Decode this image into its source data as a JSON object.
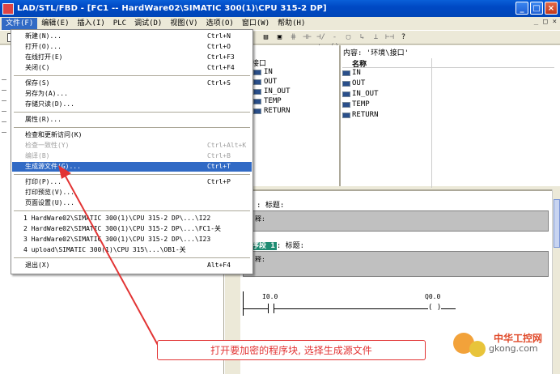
{
  "window": {
    "title": "LAD/STL/FBD  - [FC1 -- HardWare02\\SIMATIC 300(1)\\CPU 315-2 DP]",
    "min": "_",
    "max": "□",
    "close": "×"
  },
  "menubar": {
    "items": [
      "文件(F)",
      "编辑(E)",
      "插入(I)",
      "PLC",
      "调试(D)",
      "视图(V)",
      "选项(O)",
      "窗口(W)",
      "帮助(H)"
    ],
    "mdi_controls": [
      "_",
      "□",
      "×"
    ]
  },
  "file_menu": {
    "items": [
      {
        "label": "新建(N)...",
        "shortcut": "Ctrl+N",
        "state": "normal"
      },
      {
        "label": "打开(O)...",
        "shortcut": "Ctrl+O",
        "state": "normal"
      },
      {
        "label": "在线打开(E)",
        "shortcut": "Ctrl+F3",
        "state": "normal"
      },
      {
        "label": "关闭(C)",
        "shortcut": "Ctrl+F4",
        "state": "normal"
      },
      {
        "label": "保存(S)",
        "shortcut": "Ctrl+S",
        "state": "normal"
      },
      {
        "label": "另存为(A)...",
        "shortcut": "",
        "state": "normal"
      },
      {
        "label": "存储只读(D)...",
        "shortcut": "",
        "state": "normal"
      },
      {
        "label": "属性(R)...",
        "shortcut": "",
        "state": "normal"
      },
      {
        "label": "检查和更新访问(K)",
        "shortcut": "",
        "state": "normal"
      },
      {
        "label": "检查一致性(Y)",
        "shortcut": "Ctrl+Alt+K",
        "state": "disabled"
      },
      {
        "label": "编译(B)",
        "shortcut": "Ctrl+B",
        "state": "disabled"
      },
      {
        "label": "生成源文件(G)...",
        "shortcut": "Ctrl+T",
        "state": "selected"
      },
      {
        "label": "打印(P)...",
        "shortcut": "Ctrl+P",
        "state": "normal"
      },
      {
        "label": "打印预览(V)...",
        "shortcut": "",
        "state": "normal"
      },
      {
        "label": "页面设置(U)...",
        "shortcut": "",
        "state": "normal"
      },
      {
        "label": "1 HardWare02\\SIMATIC 300(1)\\CPU 315-2 DP\\...\\I22",
        "shortcut": "",
        "state": "normal"
      },
      {
        "label": "2 HardWare02\\SIMATIC 300(1)\\CPU 315-2 DP\\...\\FC1-关",
        "shortcut": "",
        "state": "normal"
      },
      {
        "label": "3 HardWare02\\SIMATIC 300(1)\\CPU 315-2 DP\\...\\I23",
        "shortcut": "",
        "state": "normal"
      },
      {
        "label": "4 upload\\SIMATIC 300(1)\\CPU 315\\...\\OB1-关",
        "shortcut": "",
        "state": "normal"
      },
      {
        "label": "退出(X)",
        "shortcut": "Alt+F4",
        "state": "normal"
      }
    ]
  },
  "toolbar": {
    "icons": [
      "table-icon",
      "window-icon",
      "grid-icon",
      "contact-no-icon",
      "contact-nc-icon",
      "coil-icon",
      "box-icon",
      "branch-open-icon",
      "branch-close-icon",
      "connection-icon",
      "help-icon"
    ],
    "glyphs": [
      "▤",
      "▣",
      "⋕",
      "⊣⊢",
      "⊣/⊢",
      "-()",
      "▢",
      "↳",
      "⊥",
      "⊢⊣",
      "?"
    ]
  },
  "interface_tree": {
    "root": "接口",
    "items": [
      "IN",
      "OUT",
      "IN_OUT",
      "TEMP",
      "RETURN"
    ]
  },
  "content_panel": {
    "title": "内容: '环境\\接口'",
    "column": "名称",
    "items": [
      "IN",
      "OUT",
      "IN_OUT",
      "TEMP",
      "RETURN"
    ]
  },
  "editor": {
    "block_title": ": 标题:",
    "comment1": "释:",
    "network_tag": "程序段 1",
    "network_title": ": 标题:",
    "comment2": "释:",
    "contact_addr": "I0.0",
    "coil_addr": "Q0.0"
  },
  "annotation": {
    "text": "打开要加密的程序块, 选择生成源文件",
    "color": "#e23434"
  },
  "watermark": {
    "cn": "中华工控网",
    "en": "gkong.com"
  }
}
